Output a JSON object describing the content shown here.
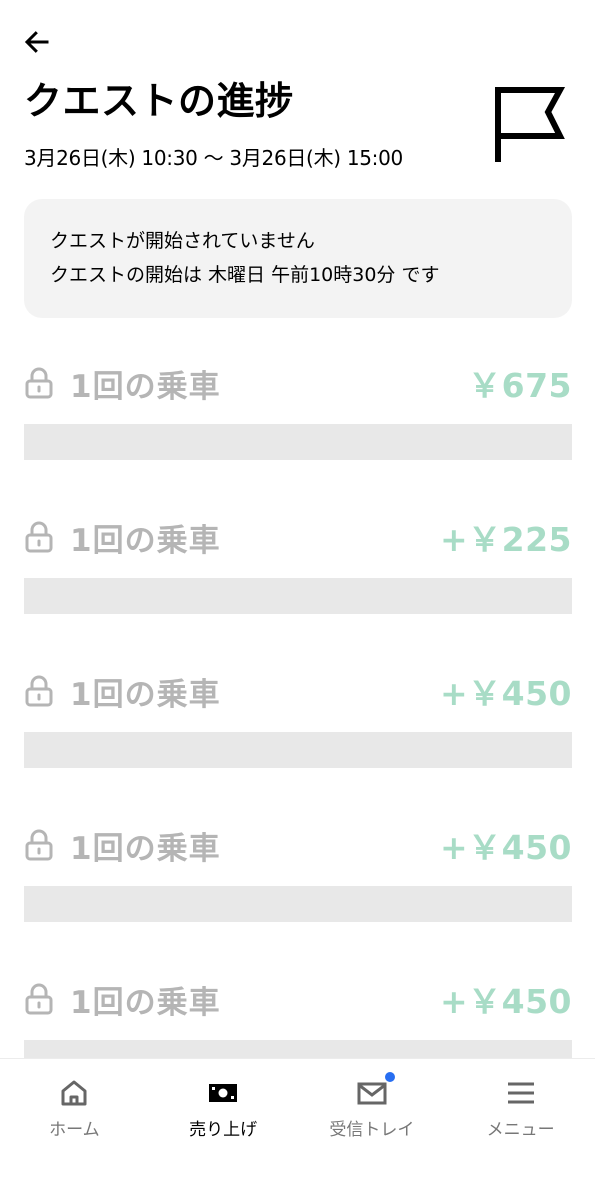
{
  "header": {
    "title": "クエストの進捗",
    "date_range": "3月26日(木) 10:30 〜 3月26日(木) 15:00",
    "back_icon": "arrow-left-icon",
    "flag_icon": "flag-icon"
  },
  "notice": {
    "line1": "クエストが開始されていません",
    "line2": "クエストの開始は 木曜日 午前10時30分 です"
  },
  "quests": [
    {
      "label": "1回の乗車",
      "reward": "￥675",
      "progress": 0,
      "locked": true
    },
    {
      "label": "1回の乗車",
      "reward": "+￥225",
      "progress": 0,
      "locked": true
    },
    {
      "label": "1回の乗車",
      "reward": "+￥450",
      "progress": 0,
      "locked": true
    },
    {
      "label": "1回の乗車",
      "reward": "+￥450",
      "progress": 0,
      "locked": true
    },
    {
      "label": "1回の乗車",
      "reward": "+￥450",
      "progress": 0,
      "locked": true
    }
  ],
  "colors": {
    "accent": "#276ef1",
    "reward": "#a8dcc6",
    "locked_text": "#b5b5b5",
    "bar_bg": "#e8e8e8"
  },
  "nav": {
    "items": [
      {
        "label": "ホーム",
        "icon": "home-icon",
        "active": false
      },
      {
        "label": "売り上げ",
        "icon": "earnings-icon",
        "active": true
      },
      {
        "label": "受信トレイ",
        "icon": "mail-icon",
        "active": false,
        "badge": true
      },
      {
        "label": "メニュー",
        "icon": "menu-icon",
        "active": false
      }
    ]
  }
}
